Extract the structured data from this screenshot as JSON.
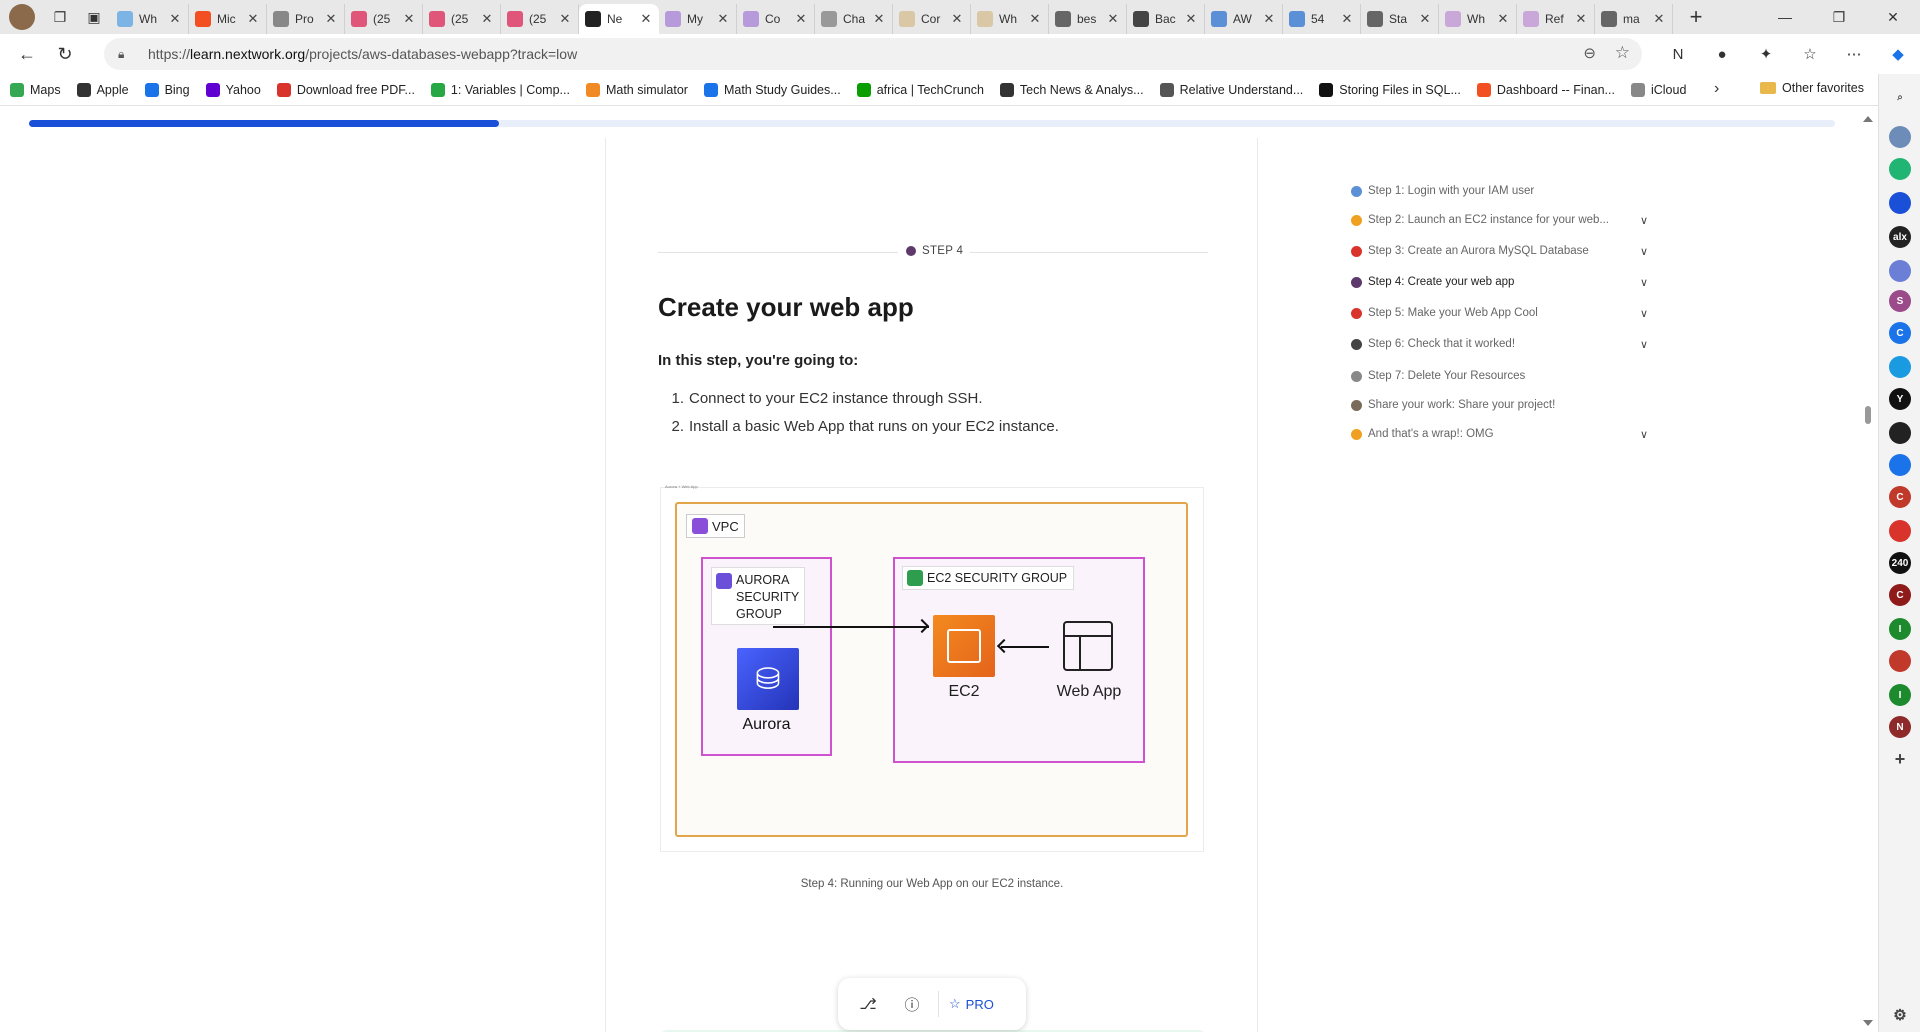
{
  "tabs": [
    {
      "label": "Wh",
      "color": "#7db4e6"
    },
    {
      "label": "Mic",
      "color": "#f25022"
    },
    {
      "label": "Pro",
      "color": "#888888"
    },
    {
      "label": "(25",
      "color": "#e0567a"
    },
    {
      "label": "(25",
      "color": "#e0567a"
    },
    {
      "label": "(25",
      "color": "#e0567a"
    },
    {
      "label": "Ne",
      "color": "#222222",
      "active": true
    },
    {
      "label": "My",
      "color": "#b79ad9"
    },
    {
      "label": "Co",
      "color": "#b79ad9"
    },
    {
      "label": "Cha",
      "color": "#999999"
    },
    {
      "label": "Cor",
      "color": "#d9c7a6"
    },
    {
      "label": "Wh",
      "color": "#d9c7a6"
    },
    {
      "label": "bes",
      "color": "#666666"
    },
    {
      "label": "Bac",
      "color": "#444444"
    },
    {
      "label": "AW",
      "color": "#5b8fd6"
    },
    {
      "label": "54",
      "color": "#5b8fd6"
    },
    {
      "label": "Sta",
      "color": "#666666"
    },
    {
      "label": "Wh",
      "color": "#c9a8d9"
    },
    {
      "label": "Ref",
      "color": "#c9a8d9"
    },
    {
      "label": "ma",
      "color": "#666666"
    }
  ],
  "address": {
    "scheme": "https://",
    "host": "learn.nextwork.org",
    "path": "/projects/aws-databases-webapp?track=low"
  },
  "bookmarks": [
    {
      "label": "Maps",
      "color": "#34a853"
    },
    {
      "label": "Apple",
      "color": "#333333"
    },
    {
      "label": "Bing",
      "color": "#1a73e8"
    },
    {
      "label": "Yahoo",
      "color": "#6001d2"
    },
    {
      "label": "Download free PDF...",
      "color": "#d9342b"
    },
    {
      "label": "1: Variables | Comp...",
      "color": "#27a844"
    },
    {
      "label": "Math simulator",
      "color": "#f08a24"
    },
    {
      "label": "Math Study Guides...",
      "color": "#1a73e8"
    },
    {
      "label": "africa | TechCrunch",
      "color": "#0a9e01"
    },
    {
      "label": "Tech News & Analys...",
      "color": "#333333"
    },
    {
      "label": "Relative Understand...",
      "color": "#555555"
    },
    {
      "label": "Storing Files in SQL...",
      "color": "#111111"
    },
    {
      "label": "Dashboard -- Finan...",
      "color": "#f25022"
    },
    {
      "label": "iCloud",
      "color": "#888888"
    }
  ],
  "other_favorites": "Other favorites",
  "progress": 0.26,
  "step": {
    "tag": "STEP 4",
    "title": "Create your web app",
    "intro": "In this step, you're going to:",
    "items": [
      "Connect to your EC2 instance through SSH.",
      "Install a basic Web App that runs on your EC2 instance."
    ],
    "caption": "Step 4: Running our Web App on our EC2 instance."
  },
  "diagram": {
    "tiny_caption": "Aurora + Web App",
    "vpc": "VPC",
    "aurora_group": [
      "AURORA",
      "SECURITY",
      "GROUP"
    ],
    "aurora": "Aurora",
    "ec2_group": "EC2 SECURITY GROUP",
    "ec2": "EC2",
    "webapp": "Web App"
  },
  "toolbar": {
    "pro": "PRO"
  },
  "stepnav": [
    {
      "label": "Step 1: Login with your IAM user",
      "color": "#5b8fd6",
      "chevron": false
    },
    {
      "label": "Step 2: Launch an EC2 instance for your web...",
      "color": "#f0a020",
      "chevron": true
    },
    {
      "label": "Step 3: Create an Aurora MySQL Database",
      "color": "#d9342b",
      "chevron": true
    },
    {
      "label": "Step 4: Create your web app",
      "color": "#5d3a6b",
      "chevron": true,
      "current": true
    },
    {
      "label": "Step 5: Make your Web App Cool",
      "color": "#d9342b",
      "chevron": true
    },
    {
      "label": "Step 6: Check that it worked!",
      "color": "#444444",
      "chevron": true
    },
    {
      "label": "Step 7: Delete Your Resources",
      "color": "#888888",
      "chevron": false
    },
    {
      "label": "Share your work: Share your project!",
      "color": "#7a6a5a",
      "chevron": false
    },
    {
      "label": "And that's a wrap!: OMG",
      "color": "#f0a020",
      "chevron": true
    }
  ],
  "sidebar": [
    {
      "label": "",
      "color": "#6e8cb8"
    },
    {
      "label": "",
      "color": "#21b573"
    },
    {
      "label": "",
      "color": "#1a4fd8"
    },
    {
      "label": "alx",
      "color": "#222222"
    },
    {
      "label": "",
      "color": "#6b7fd6"
    },
    {
      "label": "S",
      "color": "#9b4a8a"
    },
    {
      "label": "C",
      "color": "#1a73e8"
    },
    {
      "label": "",
      "color": "#1a9ae0"
    },
    {
      "label": "Y",
      "color": "#111111"
    },
    {
      "label": "",
      "color": "#222222"
    },
    {
      "label": "",
      "color": "#1a73e8"
    },
    {
      "label": "C",
      "color": "#c0392b"
    },
    {
      "label": "",
      "color": "#d9342b"
    },
    {
      "label": "240",
      "color": "#111111"
    },
    {
      "label": "C",
      "color": "#8e1a1a"
    },
    {
      "label": "I",
      "color": "#1e8a2e"
    },
    {
      "label": "",
      "color": "#c0392b"
    },
    {
      "label": "I",
      "color": "#1e8a2e"
    },
    {
      "label": "N",
      "color": "#8e2a2a"
    }
  ]
}
